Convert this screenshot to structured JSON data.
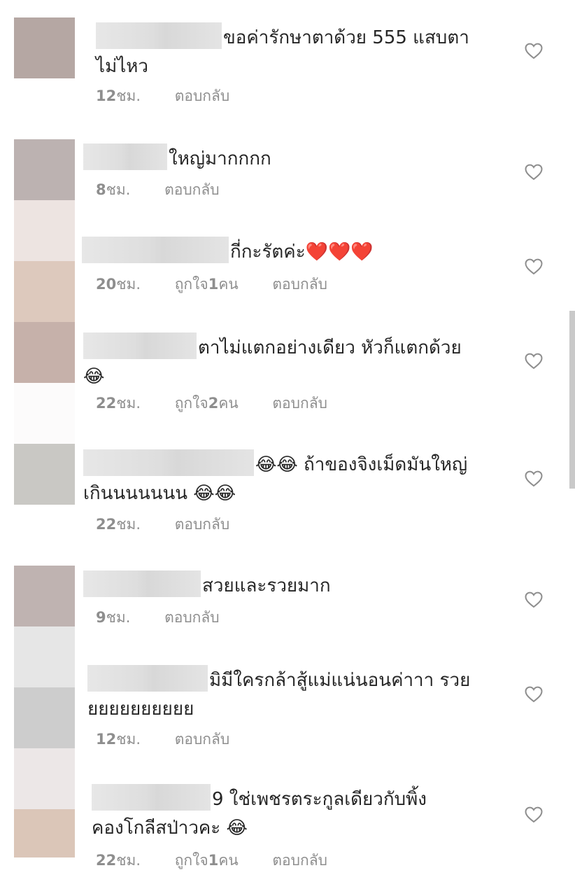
{
  "ui": {
    "heart_icon": "heart-outline-icon",
    "colors": {
      "text": "#262626",
      "meta": "#8e8e8e",
      "heart_stroke": "#8e8e8e",
      "emoji_heart": "#e0202e",
      "emoji_face": "#f7c631"
    },
    "avatar_tiles": [
      "#b5a7a3",
      "#ffffff",
      "#bcb2b1",
      "#ede4e1",
      "#ddc9bd",
      "#c6b1aa",
      "#fcfbfb",
      "#c9c8c4",
      "#ffffff",
      "#bfb3b1",
      "#e6e6e6",
      "#cdcdcd",
      "#ece7e7",
      "#dbc6b8"
    ]
  },
  "comments": [
    {
      "text": "ขอค่ารักษาตาด้วย 555 แสบตา\nไม่ไหว",
      "time_num": "12",
      "time_unit": " ชม.",
      "likes_num": "",
      "likes_pre": "",
      "likes_post": "",
      "reply": "ตอบกลับ"
    },
    {
      "text": "ใหญ่มากกกก",
      "time_num": "8",
      "time_unit": " ชม.",
      "likes_num": "",
      "likes_pre": "",
      "likes_post": "",
      "reply": "ตอบกลับ"
    },
    {
      "text": "กี่กะรัตค่ะ❤️❤️❤️",
      "time_num": "20",
      "time_unit": " ชม.",
      "likes_pre": "ถูกใจ ",
      "likes_num": "1",
      "likes_post": " คน",
      "reply": "ตอบกลับ"
    },
    {
      "text": "ตาไม่แตกอย่างเดียว หัวก็แตกด้วย\n😂",
      "time_num": "22",
      "time_unit": " ชม.",
      "likes_pre": "ถูกใจ ",
      "likes_num": "2",
      "likes_post": " คน",
      "reply": "ตอบกลับ"
    },
    {
      "text": "😂😂 ถ้าของจิงเม็ดมันใหญ่\nเกินนนนนนน 😂😂",
      "time_num": "22",
      "time_unit": " ชม.",
      "likes_num": "",
      "likes_pre": "",
      "likes_post": "",
      "reply": "ตอบกลับ"
    },
    {
      "text": "สวยและรวยมาก",
      "time_num": "9",
      "time_unit": " ชม.",
      "likes_num": "",
      "likes_pre": "",
      "likes_post": "",
      "reply": "ตอบกลับ"
    },
    {
      "text": "มิมีใครกล้าสู้แม่แน่นอนค่าาา รวย\nยยยยยยยยยย",
      "time_num": "12",
      "time_unit": " ชม.",
      "likes_num": "",
      "likes_pre": "",
      "likes_post": "",
      "reply": "ตอบกลับ"
    },
    {
      "text": "9 ใช่เพชรตระกูลเดียวกับพิ้ง\nคองโกลีสป่าวคะ 😂",
      "time_num": "22",
      "time_unit": " ชม.",
      "likes_pre": "ถูกใจ ",
      "likes_num": "1",
      "likes_post": " คน",
      "reply": "ตอบกลับ"
    }
  ]
}
